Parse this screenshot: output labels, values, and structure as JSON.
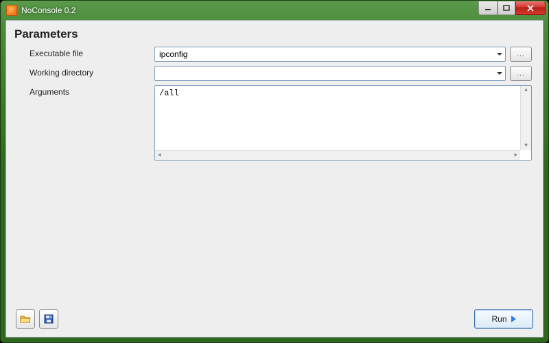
{
  "window": {
    "title": "NoConsole 0.2"
  },
  "section": {
    "title": "Parameters"
  },
  "fields": {
    "executable": {
      "label": "Executable file",
      "value": "ipconfig",
      "browse_label": "..."
    },
    "working_dir": {
      "label": "Working directory",
      "value": "",
      "browse_label": "..."
    },
    "arguments": {
      "label": "Arguments",
      "value": "/all"
    }
  },
  "actions": {
    "run_label": "Run"
  }
}
